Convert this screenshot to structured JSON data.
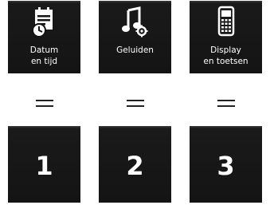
{
  "menu": {
    "items": [
      {
        "label": "Datum\nen tijd",
        "icon": "calendar-clock-icon"
      },
      {
        "label": "Geluiden",
        "icon": "music-note-gear-icon"
      },
      {
        "label": "Display\nen toetsen",
        "icon": "handset-display-icon"
      }
    ]
  },
  "keys": [
    "1",
    "2",
    "3"
  ]
}
